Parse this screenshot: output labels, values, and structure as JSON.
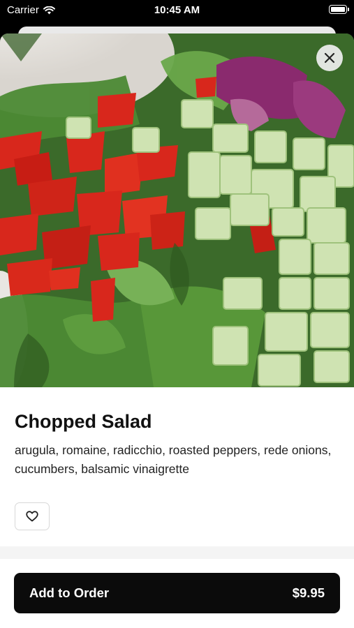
{
  "status_bar": {
    "carrier": "Carrier",
    "time": "10:45 AM"
  },
  "item": {
    "name": "Chopped Salad",
    "description": "arugula, romaine, radicchio, roasted peppers, rede onions, cucumbers, balsamic vinaigrette",
    "image_subject": "chopped salad"
  },
  "icons": {
    "close": "close-icon",
    "favorite": "heart-icon",
    "wifi": "wifi-icon",
    "battery": "battery-icon"
  },
  "order_button": {
    "label": "Add to Order",
    "price": "$9.95"
  },
  "colors": {
    "button_bg": "#0b0b0b",
    "button_text": "#ffffff",
    "title_text": "#111111"
  }
}
